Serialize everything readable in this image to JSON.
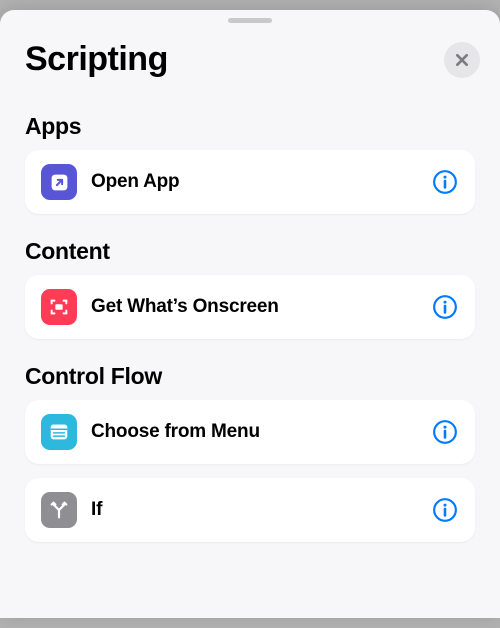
{
  "title": "Scripting",
  "colors": {
    "accent": "#007aff",
    "icon_purple": "#5856d6",
    "icon_red": "#ff3b56",
    "icon_cyan": "#2db9dd",
    "icon_gray": "#8e8e93"
  },
  "sections": [
    {
      "header": "Apps",
      "items": [
        {
          "label": "Open App",
          "icon": "arrow-up-right-square-icon",
          "color": "#5856d6"
        }
      ]
    },
    {
      "header": "Content",
      "items": [
        {
          "label": "Get What’s Onscreen",
          "icon": "screen-capture-icon",
          "color": "#ff3b56"
        }
      ]
    },
    {
      "header": "Control Flow",
      "items": [
        {
          "label": "Choose from Menu",
          "icon": "menu-list-icon",
          "color": "#2db9dd"
        },
        {
          "label": "If",
          "icon": "branch-icon",
          "color": "#8e8e93"
        }
      ]
    }
  ]
}
